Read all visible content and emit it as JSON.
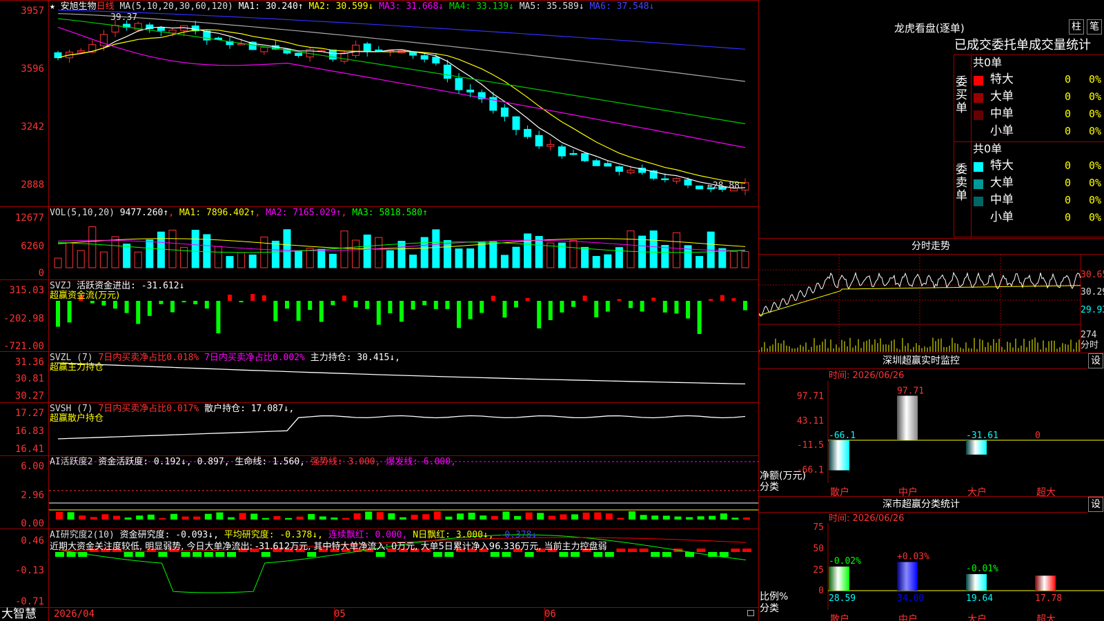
{
  "stock": {
    "star": "★",
    "name": "安旭生物",
    "period": "日线"
  },
  "ma": {
    "head": "MA(5,10,20,30,60,120)",
    "items": [
      {
        "label": "MA1: 30.240↑",
        "color": "#ffffff"
      },
      {
        "label": "MA2: 30.599↓",
        "color": "#ffff00"
      },
      {
        "label": "MA3: 31.668↓",
        "color": "#ff00ff"
      },
      {
        "label": "MA4: 33.139↓",
        "color": "#00dd00"
      },
      {
        "label": "MA5: 35.589↓",
        "color": "#dddddd"
      },
      {
        "label": "MA6: 37.548↓",
        "color": "#4444ff"
      }
    ],
    "colors": [
      "#ffffff",
      "#ffff00",
      "#ff00ff",
      "#00cc00",
      "#aaaaaa",
      "#3030ff"
    ]
  },
  "price_axis": [
    "3957",
    "3596",
    "3242",
    "2888"
  ],
  "price_annot": {
    "high": "39.37",
    "low": "←28.88"
  },
  "vol": {
    "head": "VOL(5,10,20)",
    "value": "9477.260↑",
    "items": [
      {
        "label": "MA1: 7896.402↑",
        "color": "#ffff00"
      },
      {
        "label": "MA2: 7165.029↑",
        "color": "#ff00ff"
      },
      {
        "label": "MA3: 5818.580↑",
        "color": "#00ff00"
      }
    ],
    "axis": [
      "12677",
      "6260",
      "0"
    ]
  },
  "svzj": {
    "head": "SVZJ",
    "label": "活跃资金进出: -31.612↓",
    "sub": "超赢资金流(万元)",
    "axis": [
      "315.03",
      "-202.98",
      "-721.00"
    ]
  },
  "svzl": {
    "head": "SVZL (7)",
    "a": "7日内买卖净占比0.018%",
    "b": "7日内买卖净占比0.002%",
    "c": "主力持仓: 30.415↓,",
    "sub": "超赢主力持仓",
    "axis": [
      "31.36",
      "30.81",
      "30.27"
    ]
  },
  "svsh": {
    "head": "SVSH (7)",
    "a": "7日内买卖净占比0.017%",
    "c": "散户持仓: 17.087↓,",
    "sub": "超赢散户持仓",
    "axis": [
      "17.27",
      "16.83",
      "16.41"
    ]
  },
  "ai1": {
    "head": "AI活跃度2",
    "a": "资金活跃度: 0.192↓, 0.897,",
    "b": "生命线: 1.560,",
    "c": "强势线: 3.000,",
    "d": "爆发线: 6.000,",
    "axis": [
      "6.00",
      "2.96",
      "0.00"
    ]
  },
  "ai2": {
    "head": "AI研究度2(10)",
    "a": "资金研究度: -0.093↓,",
    "b": "平均研究度: -0.378↓,",
    "c": "连续飘红: 0.000,",
    "d": "N日飘红: 3.000↓,",
    "e": "-0.378↓",
    "text": "近期大资金关注度较低, 明显弱势, 今日大单净流出: -31.612万元, 其中特大单净流入: 0万元, 大单5日累计净入96.336万元, 当前主力控盘弱",
    "axis": [
      "0.46",
      "-0.13",
      "-0.71"
    ]
  },
  "dates": {
    "d1": "2026/04",
    "d2": "05",
    "d3": "06"
  },
  "brand": "大智慧",
  "lhb": {
    "title": "龙虎看盘(逐单)",
    "btn1": "柱",
    "btn2": "笔",
    "header": "已成交委托单成交量统计",
    "buy_label": "委买单",
    "buy_total": "共0单",
    "sell_label": "委卖单",
    "sell_total": "共0单",
    "buy_rows": [
      {
        "name": "特大",
        "n": "0",
        "p": "0%",
        "color": "#ff0000"
      },
      {
        "name": "大单",
        "n": "0",
        "p": "0%",
        "color": "#990000"
      },
      {
        "name": "中单",
        "n": "0",
        "p": "0%",
        "color": "#660000"
      },
      {
        "name": "小单",
        "n": "0",
        "p": "0%",
        "color": ""
      }
    ],
    "sell_rows": [
      {
        "name": "特大",
        "n": "0",
        "p": "0%",
        "color": "#00ffff"
      },
      {
        "name": "大单",
        "n": "0",
        "p": "0%",
        "color": "#009999"
      },
      {
        "name": "中单",
        "n": "0",
        "p": "0%",
        "color": "#006666"
      },
      {
        "name": "小单",
        "n": "0",
        "p": "0%",
        "color": ""
      }
    ]
  },
  "fenshi": {
    "title": "分时走势",
    "axis": [
      "30.65",
      "30.29",
      "29.93"
    ],
    "vol_top": "274",
    "vol_label": "分时"
  },
  "monitor": {
    "title": "深圳超赢实时监控",
    "btn": "设",
    "time": "时间: 2026/06/26",
    "axis": [
      "97.71",
      "43.11",
      "-11.5",
      "-66.1"
    ],
    "unit": "净额(万元)",
    "cat_label": "分类",
    "cats": [
      "散户",
      "中户",
      "大户",
      "超大"
    ],
    "values": [
      -66.1,
      97.71,
      -31.61,
      0
    ],
    "labels": [
      "-66.1",
      "97.71",
      "-31.61",
      "0"
    ]
  },
  "classify": {
    "title": "深市超赢分类统计",
    "btn": "设",
    "time": "时间: 2026/06/26",
    "axis": [
      "75",
      "50",
      "25",
      "0"
    ],
    "unit": "比例%",
    "cat_label": "分类",
    "cats": [
      "散户",
      "中户",
      "大户",
      "超大"
    ],
    "values": [
      28.59,
      34.0,
      19.64,
      17.78
    ],
    "labels": [
      "28.59",
      "34.00",
      "19.64",
      "17.78"
    ],
    "changes": [
      "-0.02%",
      "+0.03%",
      "-0.01%",
      ""
    ]
  }
}
